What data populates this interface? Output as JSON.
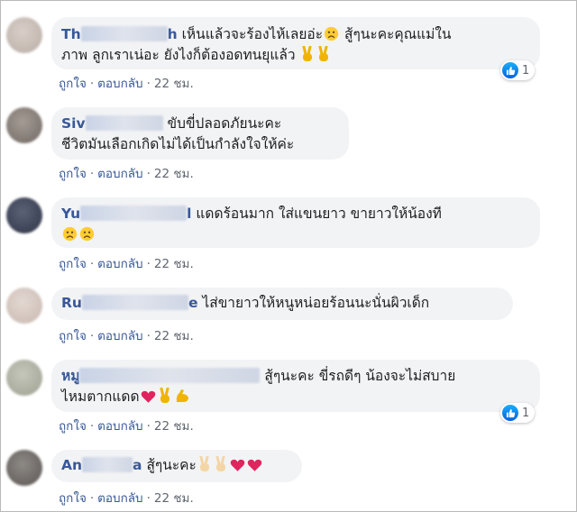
{
  "comments": [
    {
      "author_start": "Th",
      "author_end": "h",
      "text": "เห็นแล้วจะร้องไห้เลยอ่ะ",
      "text_2": "สู้ๆนะคะคุณแม่ใน",
      "line2": "ภาพ ลูกเราเน่อะ ยังไงก็ต้องอดทนยุแล้ว",
      "emojis": [
        "sad-face",
        "victory-hand",
        "victory-hand"
      ],
      "like_count": "1",
      "actions": {
        "like": "ถูกใจ",
        "reply": "ตอบกลับ",
        "time": "22 ชม."
      }
    },
    {
      "author_start": "Siv",
      "text": "ขับขี่ปลอดภัยนะคะ",
      "line2": "ชีวิตมันเลือกเกิดไม่ได้เป็นกำลังใจให้ค่ะ",
      "actions": {
        "like": "ถูกใจ",
        "reply": "ตอบกลับ",
        "time": "22 ชม."
      }
    },
    {
      "author_start": "Yu",
      "author_end": "l",
      "text": "แดดร้อนมาก ใส่แขนยาว ขายาวให้น้องที",
      "emojis": [
        "sad-face",
        "sad-face"
      ],
      "actions": {
        "like": "ถูกใจ",
        "reply": "ตอบกลับ",
        "time": "22 ชม."
      }
    },
    {
      "author_start": "Ru",
      "author_end": "e",
      "text": "ไส่ขายาวให้หนูหน่อยร้อนนะนั่นผิวเด็ก",
      "actions": {
        "like": "ถูกใจ",
        "reply": "ตอบกลับ",
        "time": "22 ชม."
      }
    },
    {
      "author_start": "หมู",
      "text": "สู้ๆนะคะ ขี่รถดีๆ น้องจะไม่สบาย",
      "line2": "ไหมตากแดด",
      "emojis": [
        "red-heart",
        "victory-hand",
        "flexed-biceps"
      ],
      "like_count": "1",
      "actions": {
        "like": "ถูกใจ",
        "reply": "ตอบกลับ",
        "time": "22 ชม."
      }
    },
    {
      "author_start": "An",
      "author_end": "a",
      "text": "สู้ๆนะคะ",
      "emojis": [
        "victory-hand",
        "victory-hand",
        "red-heart",
        "red-heart"
      ],
      "actions": {
        "like": "ถูกใจ",
        "reply": "ตอบกลับ",
        "time": "22 ชม."
      }
    }
  ],
  "colors": {
    "author": "#385898",
    "bubble": "#f2f3f5",
    "meta": "#606770",
    "like_badge": "#1877f2"
  }
}
